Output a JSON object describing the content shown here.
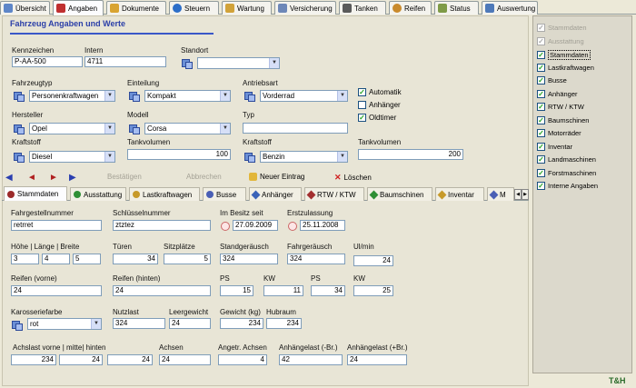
{
  "tabs": [
    {
      "label": "Übersicht",
      "icon": "overview-icon",
      "color": "#5e86c8"
    },
    {
      "label": "Angaben",
      "icon": "details-icon",
      "color": "#c03030"
    },
    {
      "label": "Dokumente",
      "icon": "documents-icon",
      "color": "#d9a431"
    },
    {
      "label": "Steuern",
      "icon": "globe-icon",
      "color": "#2c6ec8"
    },
    {
      "label": "Wartung",
      "icon": "wrench-icon",
      "color": "#d1a239"
    },
    {
      "label": "Versicherung",
      "icon": "insurance-icon",
      "color": "#6d87b8"
    },
    {
      "label": "Tanken",
      "icon": "fuel-icon",
      "color": "#5a5a5a"
    },
    {
      "label": "Reifen",
      "icon": "tire-icon",
      "color": "#c98a2c"
    },
    {
      "label": "Status",
      "icon": "status-icon",
      "color": "#7f9b47"
    },
    {
      "label": "Auswertung",
      "icon": "chart-icon",
      "color": "#4e79b9"
    }
  ],
  "section_title": "Fahrzeug Angaben und Werte",
  "form1": {
    "kennzeichen_label": "Kennzeichen",
    "kennzeichen": "P-AA-500",
    "intern_label": "Intern",
    "intern": "4711",
    "standort_label": "Standort",
    "standort": "",
    "fahrzeugtyp_label": "Fahrzeugtyp",
    "fahrzeugtyp": "Personenkraftwagen",
    "einteilung_label": "Einteilung",
    "einteilung": "Kompakt",
    "antriebsart_label": "Antriebsart",
    "antriebsart": "Vorderrad",
    "automatik_label": "Automatik",
    "anhaenger_label": "Anhänger",
    "oldtimer_label": "Oldtimer",
    "hersteller_label": "Hersteller",
    "hersteller": "Opel",
    "modell_label": "Modell",
    "modell": "Corsa",
    "typ_label": "Typ",
    "typ": "",
    "kraftstoff1_label": "Kraftstoff",
    "kraftstoff1": "Diesel",
    "tankvolumen1_label": "Tankvolumen",
    "tankvolumen1": "100",
    "kraftstoff2_label": "Kraftstoff",
    "kraftstoff2": "Benzin",
    "tankvolumen2_label": "Tankvolumen",
    "tankvolumen2": "200"
  },
  "checks": {
    "automatik": true,
    "anhaenger": false,
    "oldtimer": true
  },
  "toolbar": {
    "bestaetigen": "Bestätigen",
    "abbrechen": "Abbrechen",
    "neuer_eintrag": "Neuer Eintrag",
    "loeschen": "Löschen"
  },
  "subtabs": [
    {
      "label": "Stammdaten",
      "color": "#9b2a2a"
    },
    {
      "label": "Ausstattung",
      "color": "#2f8f35"
    },
    {
      "label": "Lastkraftwagen",
      "color": "#c79a2a"
    },
    {
      "label": "Busse",
      "color": "#4a5fb5"
    },
    {
      "label": "Anhänger",
      "color": "#3a63b8"
    },
    {
      "label": "RTW / KTW",
      "color": "#a33030"
    },
    {
      "label": "Baumschinen",
      "color": "#2f8f35"
    },
    {
      "label": "Inventar",
      "color": "#c79a2a"
    },
    {
      "label": "M",
      "color": "#4a5fb5"
    }
  ],
  "form2": {
    "fahrgestellnummer_label": "Fahrgestellnummer",
    "fahrgestellnummer": "retrret",
    "schluesselnummer_label": "Schlüsselnummer",
    "schluesselnummer": "ztztez",
    "besitz_label": "Im Besitz seit",
    "besitz": "27.09.2009",
    "erstzulassung_label": "Erstzulassung",
    "erstzulassung": "25.11.2008",
    "hlb_label": "Höhe | Länge | Breite",
    "hoehe": "3",
    "laenge": "4",
    "breite": "5",
    "tueren_label": "Türen",
    "tueren": "34",
    "sitzplaetze_label": "Sitzplätze",
    "sitzplaetze": "5",
    "standgeraeusch_label": "Standgeräusch",
    "standgeraeusch": "324",
    "fahrgeraeusch_label": "Fahrgeräusch",
    "fahrgeraeusch": "324",
    "ulmin_label": "Ul/min",
    "ulmin": "24",
    "reifen_vorne_label": "Reifen (vorne)",
    "reifen_vorne": "24",
    "reifen_hinten_label": "Reifen (hinten)",
    "reifen_hinten": "24",
    "ps1_label": "PS",
    "ps1": "15",
    "kw1_label": "KW",
    "kw1": "11",
    "ps2_label": "PS",
    "ps2": "34",
    "kw2_label": "KW",
    "kw2": "25",
    "karosseriefarbe_label": "Karosseriefarbe",
    "karosseriefarbe": "rot",
    "nutzlast_label": "Nutzlast",
    "nutzlast": "324",
    "leergewicht_label": "Leergewicht",
    "leergewicht": "24",
    "gewicht_label": "Gewicht (kg)",
    "gewicht": "234",
    "hubraum_label": "Hubraum",
    "hubraum": "234",
    "achslast_label": "Achslast vorne | mitte| hinten",
    "achslast_vorne": "234",
    "achslast_mitte": "24",
    "achslast_hinten": "24",
    "achsen_label": "Achsen",
    "achsen": "24",
    "angetr_label": "Angetr. Achsen",
    "angetr": "4",
    "anhaengelast_br_label": "Anhängelast (-Br.)",
    "anhaengelast_br": "42",
    "anhaengelast_pbr_label": "Anhängelast (+Br.)",
    "anhaengelast_pbr": "24"
  },
  "right_panel": [
    {
      "label": "Stammdaten",
      "checked": true,
      "dim": true
    },
    {
      "label": "Ausstattung",
      "checked": true,
      "dim": true
    },
    {
      "label": "Stammdaten",
      "checked": true,
      "dim": false
    },
    {
      "label": "Lastkraftwagen",
      "checked": true,
      "dim": false
    },
    {
      "label": "Busse",
      "checked": true,
      "dim": false
    },
    {
      "label": "Anhänger",
      "checked": true,
      "dim": false
    },
    {
      "label": "RTW / KTW",
      "checked": true,
      "dim": false
    },
    {
      "label": "Baumschinen",
      "checked": true,
      "dim": false
    },
    {
      "label": "Motorräder",
      "checked": true,
      "dim": false
    },
    {
      "label": "Inventar",
      "checked": true,
      "dim": false
    },
    {
      "label": "Landmaschinen",
      "checked": true,
      "dim": false
    },
    {
      "label": "Forstmaschinen",
      "checked": true,
      "dim": false
    },
    {
      "label": "Interne Angaben",
      "checked": true,
      "dim": false
    }
  ],
  "logo_text": "T&H"
}
